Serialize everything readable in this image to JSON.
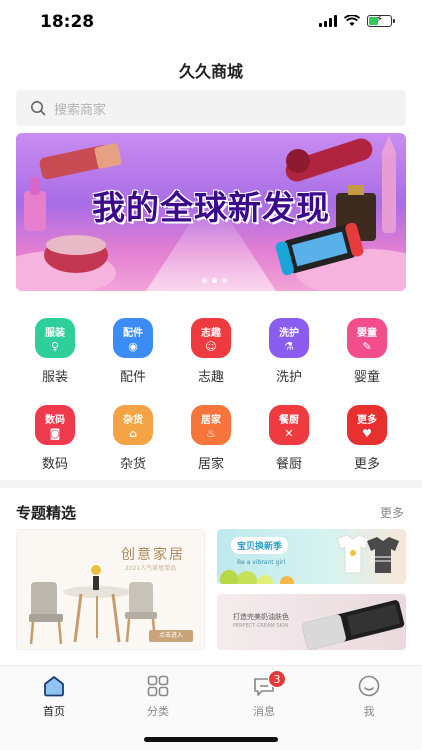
{
  "status_bar": {
    "time": "18:28"
  },
  "header": {
    "title": "久久商城"
  },
  "search": {
    "placeholder": "搜索商家"
  },
  "banner": {
    "headline": "我的全球新发现",
    "dot_count": 3,
    "active_dot": 2
  },
  "categories": [
    {
      "label": "服装",
      "icon_text": "服装",
      "color": "#2ecf9a",
      "icon": "dress-icon"
    },
    {
      "label": "配件",
      "icon_text": "配件",
      "color": "#3c8cf5",
      "icon": "bulb-icon"
    },
    {
      "label": "志趣",
      "icon_text": "志趣",
      "color": "#ef3a3f",
      "icon": "smile-icon"
    },
    {
      "label": "洗护",
      "icon_text": "洗护",
      "color": "#8a5cf0",
      "icon": "bottle-icon"
    },
    {
      "label": "婴童",
      "icon_text": "婴童",
      "color": "#f44d8c",
      "icon": "toy-icon"
    },
    {
      "label": "数码",
      "icon_text": "数码",
      "color": "#ef3a4d",
      "icon": "camera-icon"
    },
    {
      "label": "杂货",
      "icon_text": "杂货",
      "color": "#f5a445",
      "icon": "shop-icon"
    },
    {
      "label": "居家",
      "icon_text": "居家",
      "color": "#f5753a",
      "icon": "chef-hat-icon"
    },
    {
      "label": "餐厨",
      "icon_text": "餐厨",
      "color": "#ef3a3f",
      "icon": "utensils-icon"
    },
    {
      "label": "更多",
      "icon_text": "更多",
      "color": "#e83030",
      "icon": "more-icon"
    }
  ],
  "topic": {
    "title": "专题精选",
    "more_label": "更多",
    "card_big": {
      "heading": "创意家居",
      "sub": "2021人气家居单品",
      "button": "点击进入"
    },
    "card_top_right": {
      "pill": "宝贝换新季",
      "sub": "Be a vibrant girl"
    },
    "card_bottom_right": {
      "heading": "打造完美奶油肤色",
      "sub": "PERFECT CREAM SKIN"
    }
  },
  "tabbar": {
    "tabs": [
      {
        "label": "首页",
        "active": true
      },
      {
        "label": "分类",
        "active": false
      },
      {
        "label": "消息",
        "active": false,
        "badge": "3"
      },
      {
        "label": "我",
        "active": false
      }
    ]
  },
  "colors": {
    "accent": "#2f5fd0",
    "badge": "#e8393a",
    "banner_text": "#3b0a8a"
  }
}
